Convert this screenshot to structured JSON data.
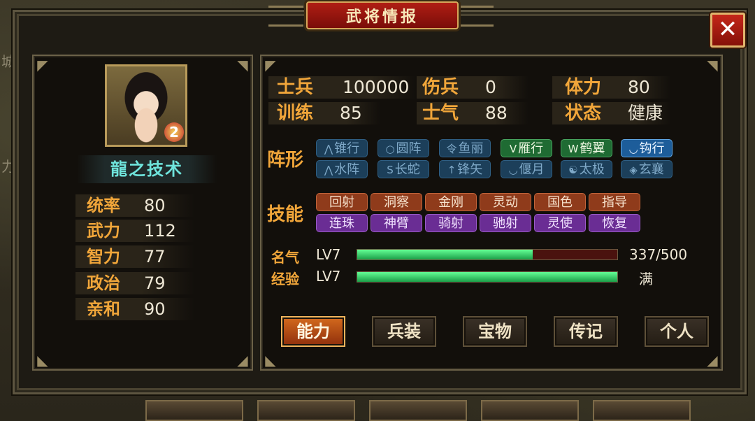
{
  "window": {
    "title": "武将情报",
    "close_label": "✕"
  },
  "bg": {
    "city_label_1": "城",
    "city_label_2": "力"
  },
  "general": {
    "name": "龍之技术",
    "level_badge": "2",
    "stats": [
      {
        "label": "统率",
        "value": "80"
      },
      {
        "label": "武力",
        "value": "112"
      },
      {
        "label": "智力",
        "value": "77"
      },
      {
        "label": "政治",
        "value": "79"
      },
      {
        "label": "亲和",
        "value": "90"
      }
    ]
  },
  "troops": [
    {
      "label": "士兵",
      "value": "100000"
    },
    {
      "label": "伤兵",
      "value": "0"
    },
    {
      "label": "体力",
      "value": "80"
    },
    {
      "label": "训练",
      "value": "85"
    },
    {
      "label": "士气",
      "value": "88"
    },
    {
      "label": "状态",
      "value": "健康"
    }
  ],
  "formation": {
    "label": "阵形",
    "items": [
      {
        "icon": "⋀",
        "label": "锥行",
        "style": "blue"
      },
      {
        "icon": "○",
        "label": "圆阵",
        "style": "blue"
      },
      {
        "icon": "令",
        "label": "鱼丽",
        "style": "blue"
      },
      {
        "icon": "V",
        "label": "雁行",
        "style": "green"
      },
      {
        "icon": "W",
        "label": "鹤翼",
        "style": "green"
      },
      {
        "icon": "◡",
        "label": "钩行",
        "style": "blue-active"
      },
      {
        "icon": "⋀",
        "label": "水阵",
        "style": "blue"
      },
      {
        "icon": "S",
        "label": "长蛇",
        "style": "blue"
      },
      {
        "icon": "↑",
        "label": "锋矢",
        "style": "blue"
      },
      {
        "icon": "◡",
        "label": "偃月",
        "style": "blue"
      },
      {
        "icon": "☯",
        "label": "太极",
        "style": "blue"
      },
      {
        "icon": "◈",
        "label": "玄襄",
        "style": "blue"
      }
    ]
  },
  "skills": {
    "label": "技能",
    "items": [
      {
        "label": "回射",
        "style": "orange"
      },
      {
        "label": "洞察",
        "style": "orange"
      },
      {
        "label": "金刚",
        "style": "orange"
      },
      {
        "label": "灵动",
        "style": "orange"
      },
      {
        "label": "国色",
        "style": "orange"
      },
      {
        "label": "指导",
        "style": "orange"
      },
      {
        "label": "连珠",
        "style": "purple"
      },
      {
        "label": "神臂",
        "style": "purple"
      },
      {
        "label": "骑射",
        "style": "purple"
      },
      {
        "label": "驰射",
        "style": "purple"
      },
      {
        "label": "灵使",
        "style": "purple"
      },
      {
        "label": "恢复",
        "style": "purple"
      }
    ]
  },
  "fame": {
    "label": "名气",
    "level": "LV7",
    "progress_text": "337/500",
    "progress": 0.674
  },
  "experience": {
    "label": "经验",
    "level": "LV7",
    "progress_text": "满",
    "progress": 1.0
  },
  "tabs": [
    {
      "label": "能力",
      "active": true
    },
    {
      "label": "兵装",
      "active": false
    },
    {
      "label": "宝物",
      "active": false
    },
    {
      "label": "传记",
      "active": false
    },
    {
      "label": "个人",
      "active": false
    }
  ]
}
